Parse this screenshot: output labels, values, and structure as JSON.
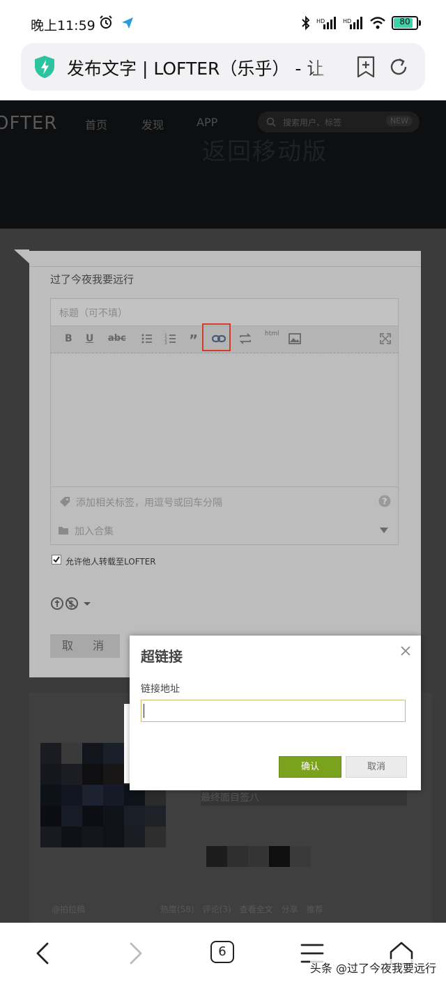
{
  "status_bar": {
    "time": "晚上11:59",
    "battery": "80"
  },
  "browser": {
    "page_title": "发布文字 | LOFTER（乐乎） - 让"
  },
  "site_nav": {
    "logo": "OFTER",
    "items": [
      "首页",
      "发现",
      "APP"
    ],
    "search_placeholder": "搜索用户、标签",
    "search_badge": "NEW",
    "banner_text": "返回移动版"
  },
  "editor": {
    "author": "过了今夜我要远行",
    "title_placeholder": "标题（可不填）",
    "toolbar": {
      "bold": "B",
      "underline": "U",
      "strike": "abc",
      "html": "html"
    },
    "tags_placeholder": "添加相关标签，用逗号或回车分隔",
    "collection_placeholder": "加入合集",
    "allow_repost_label": "允许他人转载至LOFTER",
    "cancel_label": "取　消"
  },
  "feed": {
    "row_text": "最终面目签八",
    "bottom_links": "@拍拉稿　　　　　　　　　热度(58)　评论(3)　查看全文　分享　推荐"
  },
  "dialog": {
    "title": "超链接",
    "field_label": "链接地址",
    "field_value": "",
    "confirm_label": "确认",
    "cancel_label": "取消"
  },
  "bottom_nav": {
    "tab_count": "6"
  },
  "watermark": "头条 @过了今夜我要远行"
}
